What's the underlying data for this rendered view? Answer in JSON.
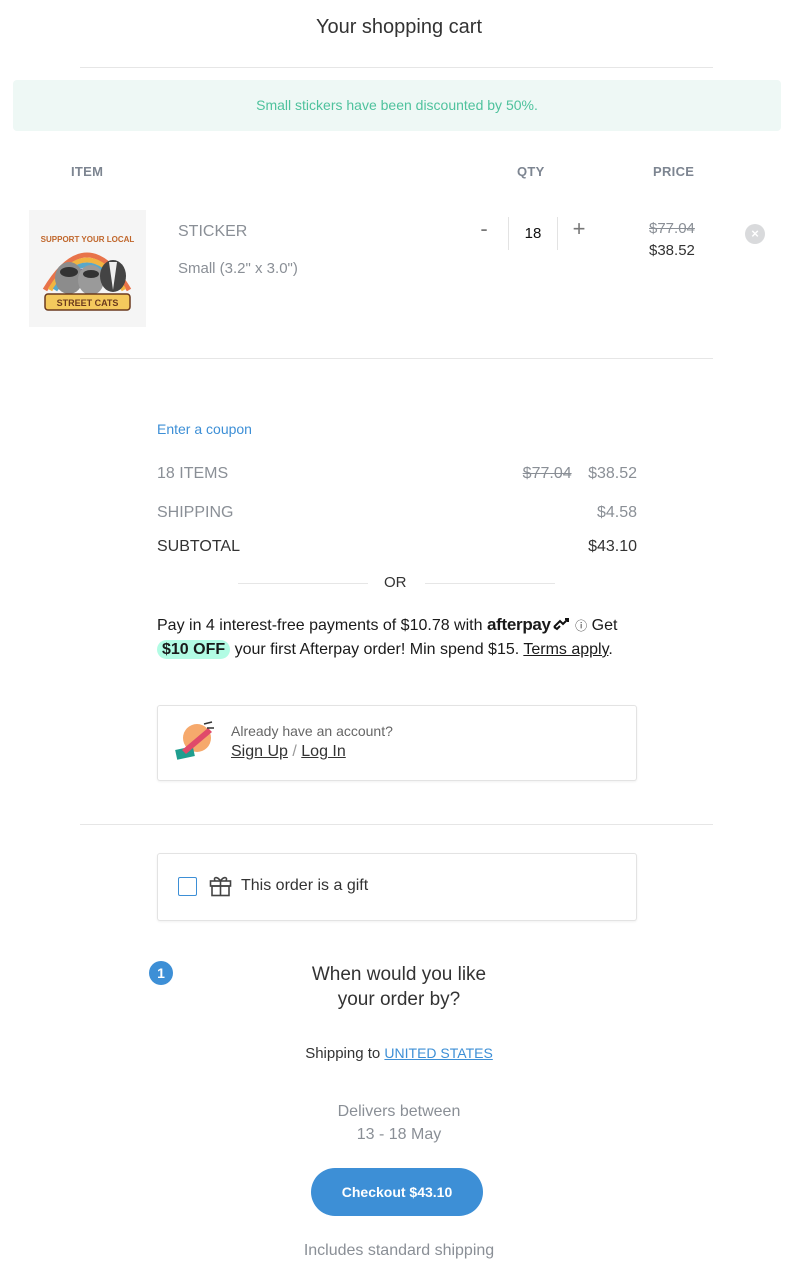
{
  "page_title": "Your shopping cart",
  "banner_text": "Small stickers have been discounted by 50%.",
  "columns": {
    "item": "ITEM",
    "qty": "QTY",
    "price": "PRICE"
  },
  "cart_item": {
    "name": "STICKER",
    "variant": "Small (3.2\" x 3.0\")",
    "image_alt": "SUPPORT YOUR LOCAL STREET CATS",
    "qty": "18",
    "qty_minus": "-",
    "qty_plus": "+",
    "original_price": "$77.04",
    "price": "$38.52",
    "remove_icon": "×"
  },
  "summary": {
    "coupon_link": "Enter a coupon",
    "items_label": "18 ITEMS",
    "items_original": "$77.04",
    "items_price": "$38.52",
    "shipping_label": "SHIPPING",
    "shipping_price": "$4.58",
    "subtotal_label": "SUBTOTAL",
    "subtotal_price": "$43.10",
    "or_text": "OR"
  },
  "afterpay": {
    "text_before": "Pay in 4 interest-free payments of $10.78 with",
    "logo_text": "afterpay",
    "info_icon": "ⓘ",
    "text_get": "Get",
    "badge": "$10 OFF",
    "text_after": "your first Afterpay order! Min spend $15.",
    "terms": "Terms apply",
    "period": "."
  },
  "account": {
    "prompt": "Already have an account?",
    "signup": "Sign Up",
    "separator": "/",
    "login": "Log In"
  },
  "gift": {
    "label": "This order is a gift"
  },
  "delivery": {
    "step": "1",
    "heading_line1": "When would you like",
    "heading_line2": "your order by?",
    "shipping_to_label": "Shipping to",
    "country": "UNITED STATES",
    "delivers_label": "Delivers between",
    "dates": "13 - 18 May",
    "checkout_button": "Checkout $43.10",
    "footnote": "Includes standard shipping"
  },
  "colors": {
    "accent": "#3d8fd6",
    "banner_bg": "#eef8f5",
    "banner_text": "#4fc29d",
    "afterpay_mint": "#b2fce4"
  }
}
